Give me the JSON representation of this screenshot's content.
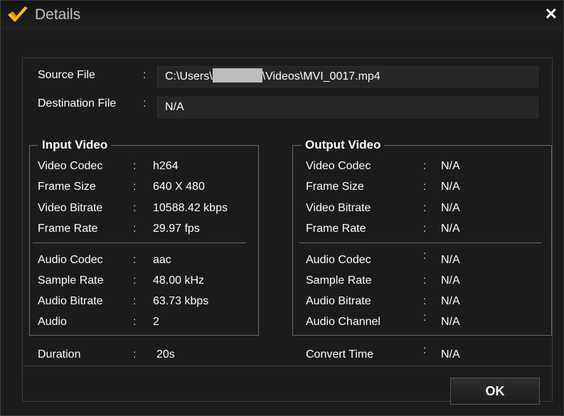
{
  "window": {
    "title": "Details"
  },
  "file": {
    "source_label": "Source File",
    "source_value_prefix": "C:\\Users\\",
    "source_value_suffix": "\\Videos\\MVI_0017.mp4",
    "dest_label": "Destination File",
    "dest_value": "N/A"
  },
  "input": {
    "title": "Input Video",
    "rows": [
      {
        "label": "Video Codec",
        "value": "h264"
      },
      {
        "label": "Frame Size",
        "value": "640 X 480"
      },
      {
        "label": "Video Bitrate",
        "value": "10588.42 kbps"
      },
      {
        "label": "Frame Rate",
        "value": "29.97 fps"
      },
      {
        "label": "Audio Codec",
        "value": "aac"
      },
      {
        "label": "Sample Rate",
        "value": "48.00 kHz"
      },
      {
        "label": "Audio Bitrate",
        "value": "63.73 kbps"
      },
      {
        "label": "Audio",
        "value": "2"
      }
    ],
    "duration_label": "Duration",
    "duration_value": "20s"
  },
  "output": {
    "title": "Output Video",
    "rows": [
      {
        "label": "Video Codec",
        "value": "N/A"
      },
      {
        "label": "Frame Size",
        "value": "N/A"
      },
      {
        "label": "Video Bitrate",
        "value": "N/A"
      },
      {
        "label": "Frame Rate",
        "value": "N/A"
      },
      {
        "label": "Audio Codec",
        "value": "N/A"
      },
      {
        "label": "Sample Rate",
        "value": "N/A"
      },
      {
        "label": "Audio Bitrate",
        "value": "N/A"
      },
      {
        "label": "Audio Channel",
        "value": "N/A"
      }
    ],
    "convert_label": "Convert Time",
    "convert_value": "N/A"
  },
  "buttons": {
    "ok_label": "OK"
  },
  "colon": ":"
}
